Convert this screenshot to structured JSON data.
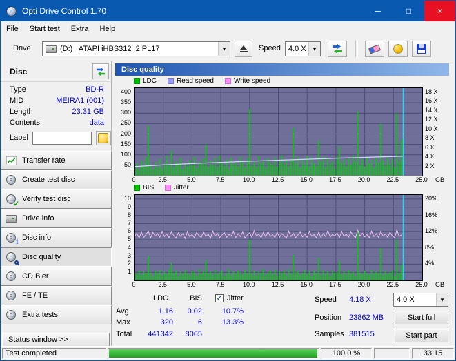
{
  "window": {
    "title": "Opti Drive Control 1.70"
  },
  "icons": {
    "check": "✓",
    "dropdown": "▾",
    "minimize": "─",
    "maximize": "□",
    "close": "×",
    "info": "i"
  },
  "menu": {
    "items": [
      "File",
      "Start test",
      "Extra",
      "Help"
    ]
  },
  "toolbar": {
    "drive_label": "Drive",
    "drive_value": "(D:)   ATAPI iHBS312  2 PL17",
    "speed_label": "Speed",
    "speed_value": "4.0 X"
  },
  "sidebar": {
    "header": "Disc",
    "info": [
      {
        "label": "Type",
        "value": "BD-R"
      },
      {
        "label": "MID",
        "value": "MEIRA1 (001)"
      },
      {
        "label": "Length",
        "value": "23.31 GB"
      },
      {
        "label": "Contents",
        "value": "data"
      }
    ],
    "label_field": {
      "label": "Label",
      "value": ""
    },
    "buttons": [
      "Transfer rate",
      "Create test disc",
      "Verify test disc",
      "Drive info",
      "Disc info",
      "Disc quality",
      "CD Bler",
      "FE / TE",
      "Extra tests"
    ],
    "active_button": "Disc quality",
    "status_window": "Status window >>"
  },
  "panel": {
    "title": "Disc quality"
  },
  "chart_data": [
    {
      "type": "bar",
      "title": "Disc quality - LDC with read speed",
      "legend": [
        {
          "label": "LDC",
          "color": "#00c000"
        },
        {
          "label": "Read speed",
          "color": "#9898ff"
        },
        {
          "label": "Write speed",
          "color": "#ff90ff"
        }
      ],
      "x_unit": "GB",
      "x_ticks": [
        "0",
        "2.5",
        "5.0",
        "7.5",
        "10.0",
        "12.5",
        "15.0",
        "17.5",
        "20.0",
        "22.5",
        "25.0"
      ],
      "x_max": 25,
      "left_axis": {
        "ticks": [
          400,
          350,
          300,
          250,
          200,
          150,
          100,
          50
        ],
        "max": 420
      },
      "right_axis": {
        "ticks": [
          "18 X",
          "16 X",
          "14 X",
          "12 X",
          "10 X",
          "8 X",
          "6 X",
          "4 X",
          "2 X"
        ],
        "values": [
          18,
          16,
          14,
          12,
          10,
          8,
          6,
          4,
          2
        ],
        "max": 18.9
      },
      "bg": "#6f6f99",
      "grid": "#4c4c7a",
      "bar_color": "#00d000",
      "bar_dx": 0.2,
      "bars": [
        35,
        60,
        28,
        72,
        45,
        88,
        240,
        52,
        30,
        66,
        40,
        82,
        34,
        58,
        95,
        48,
        120,
        38,
        70,
        55,
        85,
        32,
        62,
        44,
        76,
        50,
        92,
        36,
        68,
        58,
        80,
        150,
        42,
        74,
        52,
        88,
        38,
        96,
        60,
        46,
        78,
        34,
        86,
        56,
        70,
        44,
        90,
        64,
        38,
        82,
        320,
        48,
        72,
        40,
        94,
        58,
        76,
        36,
        84,
        62,
        50,
        88,
        42,
        68,
        98,
        54,
        80,
        46,
        74,
        230,
        58,
        90,
        38,
        78,
        52,
        96,
        44,
        86,
        60,
        48,
        170,
        66,
        92,
        40,
        84,
        56,
        72,
        34,
        94,
        140,
        62,
        78,
        46,
        88,
        54,
        98,
        68,
        310,
        50,
        80,
        44,
        92,
        58,
        76,
        38,
        86,
        64,
        250,
        72,
        48,
        90,
        56,
        82,
        40,
        300,
        68,
        175
      ],
      "lines": [
        {
          "name": "Read speed",
          "color": "#ccd4f8",
          "x": [
            0,
            2.5,
            5,
            7.5,
            10,
            12.5,
            15,
            17.5,
            20,
            22.5,
            23.35
          ],
          "v": [
            1.98,
            2.33,
            2.62,
            2.89,
            3.13,
            3.35,
            3.56,
            3.76,
            3.95,
            4.13,
            4.18
          ]
        }
      ],
      "end_line": {
        "x": 23.35,
        "color": "#00e6ff"
      }
    },
    {
      "type": "bar",
      "title": "Disc quality - BIS with jitter",
      "legend": [
        {
          "label": "BIS",
          "color": "#00c000"
        },
        {
          "label": "Jitter",
          "color": "#ff90ff"
        }
      ],
      "x_unit": "GB",
      "x_ticks": [
        "0",
        "2.5",
        "5.0",
        "7.5",
        "10.0",
        "12.5",
        "15.0",
        "17.5",
        "20.0",
        "22.5",
        "25.0"
      ],
      "x_max": 25,
      "left_axis": {
        "ticks": [
          10,
          9,
          8,
          7,
          6,
          5,
          4,
          3,
          2,
          1
        ],
        "max": 10.5
      },
      "right_axis": {
        "ticks": [
          "20%",
          "16%",
          "12%",
          "8%",
          "4%"
        ],
        "values": [
          20,
          16,
          12,
          8,
          4
        ],
        "max": 21
      },
      "bg": "#6f6f99",
      "grid": "#4c4c7a",
      "bar_color": "#00d000",
      "bar_dx": 0.2,
      "bars": [
        1,
        0.8,
        1.2,
        0.7,
        1.1,
        0.9,
        3,
        1,
        0.6,
        1.2,
        0.9,
        1.3,
        0.7,
        1.1,
        0.8,
        1.4,
        2.2,
        0.9,
        1.2,
        0.6,
        1.1,
        0.8,
        1.3,
        0.9,
        0.7,
        1.2,
        1,
        0.6,
        1.4,
        0.8,
        1.2,
        2.5,
        0.9,
        1.1,
        0.7,
        1.3,
        0.8,
        1,
        1.2,
        0.6,
        0.9,
        1.4,
        0.7,
        1.1,
        0.8,
        1.2,
        1,
        0.7,
        1.3,
        0.9,
        5,
        0.8,
        1.2,
        0.6,
        1.1,
        0.9,
        1.4,
        0.7,
        1,
        1.2,
        0.8,
        1.3,
        0.6,
        1.1,
        0.9,
        1.2,
        0.7,
        1.4,
        0.8,
        3.2,
        1,
        1.2,
        0.7,
        0.9,
        1.3,
        0.8,
        1.1,
        0.6,
        1.2,
        0.9,
        2.8,
        0.7,
        1.3,
        0.8,
        1.1,
        0.6,
        1.2,
        0.9,
        1,
        2.4,
        0.8,
        1.2,
        0.7,
        1.3,
        0.9,
        1.1,
        0.6,
        6,
        1,
        0.8,
        1.2,
        0.9,
        0.7,
        1.3,
        0.8,
        1.1,
        0.9,
        4,
        0.7,
        1.2,
        0.8,
        1,
        1.3,
        0.6,
        5,
        0.9,
        2
      ],
      "noise_line": {
        "name": "Jitter",
        "color": "#eebcee",
        "v": [
          10.8,
          11.6,
          10.4,
          11.9,
          10.6,
          11.3,
          12.1,
          10.5,
          11.8,
          10.9,
          11.5,
          10.6,
          12,
          10.8,
          11.4,
          10.5,
          11.9,
          11.1,
          10.4,
          11.7,
          10.9,
          11.5,
          10.3,
          12,
          10.7,
          11.3,
          10.5,
          11.8,
          11,
          10.6,
          11.9,
          10.8,
          11.4,
          10.4,
          12.1,
          10.9,
          11.6,
          10.5,
          11.2,
          11.8,
          10.6,
          11.3,
          10.9,
          12,
          10.5,
          11.5,
          10.8,
          11.9,
          10.4,
          11.2,
          11.7,
          10.6,
          12.2,
          10.9,
          11.4,
          10.5,
          11.8,
          10.7,
          12,
          10.8,
          11.3,
          10.5,
          11.9,
          10.6,
          11.5,
          11,
          10.4,
          12.1,
          10.8,
          11.6,
          10.5,
          11.2,
          11.9,
          10.7,
          11.4,
          10.6,
          12,
          10.9,
          11.3,
          10.5,
          11.8,
          10.6,
          11.5,
          10.8,
          12.2,
          10.7,
          11.3,
          10.9,
          11.7,
          10.5,
          12,
          10.8,
          11.4,
          10.6,
          11.9,
          11.1,
          10.5,
          12.3,
          10.9,
          11.6,
          10.7,
          11.3,
          10.5,
          12.1,
          10.8,
          11.5,
          10.6,
          12,
          10.9,
          11.4,
          10.6,
          11.8,
          11,
          10.5,
          12.4,
          10.8,
          11.2
        ]
      },
      "end_line": {
        "x": 23.35,
        "color": "#00e6ff"
      }
    }
  ],
  "stats": {
    "col_headers": [
      "LDC",
      "BIS"
    ],
    "jitter_label": "Jitter",
    "jitter_checked": true,
    "rows": [
      {
        "label": "Avg",
        "ldc": "1.16",
        "bis": "0.02",
        "jitter": "10.7%"
      },
      {
        "label": "Max",
        "ldc": "320",
        "bis": "6",
        "jitter": "13.3%"
      },
      {
        "label": "Total",
        "ldc": "441342",
        "bis": "8065",
        "jitter": ""
      }
    ],
    "speed_label": "Speed",
    "speed_value": "4.18 X",
    "position_label": "Position",
    "position_value": "23862 MB",
    "samples_label": "Samples",
    "samples_value": "381515",
    "speed_select": "4.0 X",
    "start_full": "Start full",
    "start_part": "Start part"
  },
  "statusbar": {
    "status": "Test completed",
    "percent": "100.0 %",
    "time": "33:15",
    "progress_value": 100,
    "progress_color": "#2fbf2f"
  }
}
